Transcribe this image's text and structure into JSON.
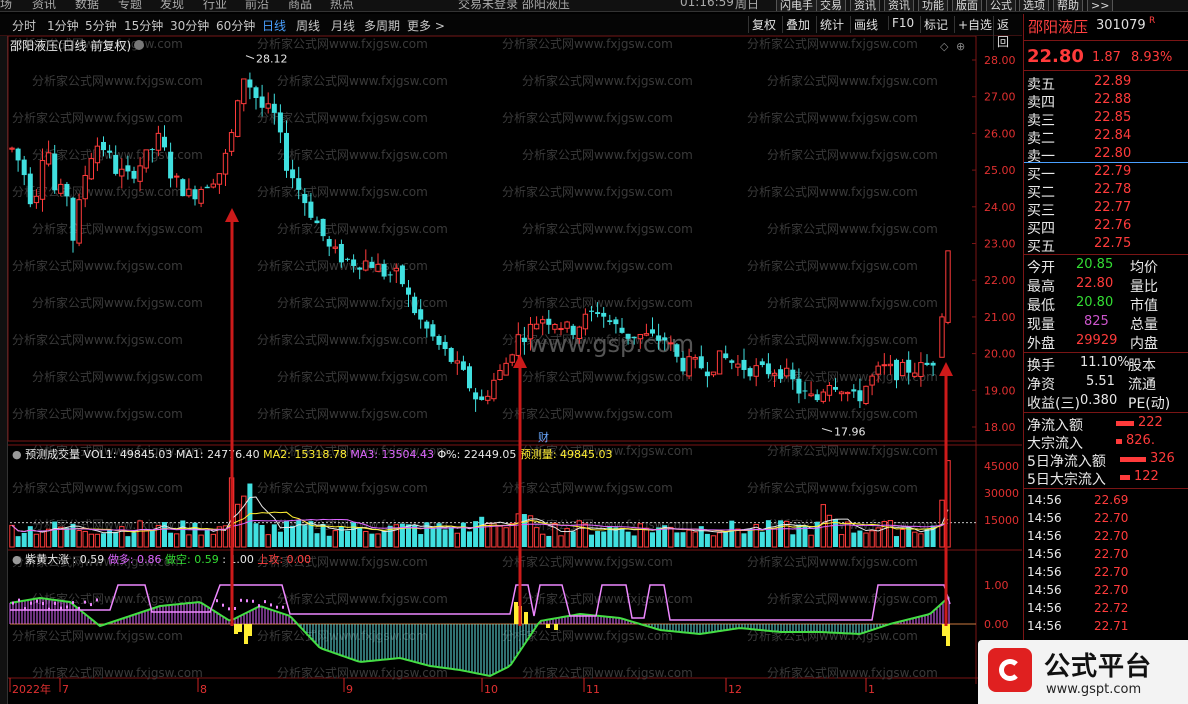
{
  "top_menu": {
    "items": [
      "场",
      "资讯",
      "数据",
      "专题",
      "发现",
      "行业",
      "前沿",
      "商品",
      "热点"
    ],
    "center_text": "交易未登录  邵阳液压",
    "time": "01:16:59",
    "weekday": "周日",
    "buttons": [
      "闪电手",
      "交易",
      "资讯",
      "资讯",
      "功能",
      "版面",
      "公式",
      "选项",
      "帮助",
      ">>"
    ]
  },
  "period_bar": {
    "periods": [
      "分时",
      "1分钟",
      "5分钟",
      "15分钟",
      "30分钟",
      "60分钟",
      "日线",
      "周线",
      "月线",
      "多周期",
      "更多 >"
    ],
    "active": "日线",
    "tools": [
      "复权",
      "叠加",
      "统计",
      "画线",
      "F10",
      "标记",
      "+自选",
      "返回"
    ]
  },
  "main_chart": {
    "title": "邵阳液压(日线 前复权)",
    "watermark": "分析家公式网www.fxjgsw.com",
    "center_watermark": "www.gsp.com",
    "high_label": "28.12",
    "low_label": "17.96",
    "y_ticks": [
      "28.00",
      "27.00",
      "26.00",
      "25.00",
      "24.00",
      "23.00",
      "22.00",
      "21.00",
      "20.00",
      "19.00",
      "18.00"
    ],
    "cai_marker": "财"
  },
  "volume_panel": {
    "name": "预测成交量",
    "vol1_label": "VOL1: 49845.03",
    "ma1_label": "MA1: 24776.40",
    "ma2_label": "MA2: 15318.78",
    "ma3_label": "MA3: 13504.43",
    "pct_label": "Φ%: 22449.05",
    "forecast_label": "预测量: 49845.03",
    "y_ticks": [
      "45000",
      "30000",
      "15000"
    ]
  },
  "indicator_panel": {
    "name": "紫黄大涨",
    "v1": ": 0.59",
    "v2": "做多: 0.86",
    "v3": "做空: 0.59",
    "v4": ": 1.00",
    "v5": "上攻: 0.00",
    "y_ticks": [
      "1.00",
      "0.00"
    ]
  },
  "x_axis": [
    "2022年",
    "7",
    "8",
    "9",
    "10",
    "11",
    "12",
    "1"
  ],
  "right_panel": {
    "name": "邵阳液压",
    "code": "301079",
    "flag": "R",
    "price": "22.80",
    "change": "1.87",
    "change_pct": "8.93%",
    "asks": [
      {
        "label": "卖五",
        "price": "22.89"
      },
      {
        "label": "卖四",
        "price": "22.88"
      },
      {
        "label": "卖三",
        "price": "22.85"
      },
      {
        "label": "卖二",
        "price": "22.84"
      },
      {
        "label": "卖一",
        "price": "22.80"
      }
    ],
    "bids": [
      {
        "label": "买一",
        "price": "22.79"
      },
      {
        "label": "买二",
        "price": "22.78"
      },
      {
        "label": "买三",
        "price": "22.77"
      },
      {
        "label": "买四",
        "price": "22.76"
      },
      {
        "label": "买五",
        "price": "22.75"
      }
    ],
    "stats": [
      {
        "l": "今开",
        "v": "20.85",
        "c": "#33dd33",
        "r": "均价"
      },
      {
        "l": "最高",
        "v": "22.80",
        "c": "#ff3b3b",
        "r": "量比"
      },
      {
        "l": "最低",
        "v": "20.80",
        "c": "#33dd33",
        "r": "市值"
      },
      {
        "l": "现量",
        "v": "825",
        "c": "#cc55cc",
        "r": "总量"
      },
      {
        "l": "外盘",
        "v": "29929",
        "c": "#ff3b3b",
        "r": "内盘"
      }
    ],
    "stats2": [
      {
        "l": "换手",
        "v": "11.10%",
        "r": "股本"
      },
      {
        "l": "净资",
        "v": "5.51",
        "r": "流通"
      },
      {
        "l": "收益(三)",
        "v": "0.380",
        "r": "PE(动)"
      }
    ],
    "flows": [
      {
        "l": "净流入额",
        "v": "222"
      },
      {
        "l": "大宗流入",
        "v": "826."
      },
      {
        "l": "5日净流入额",
        "v": "326"
      },
      {
        "l": "5日大宗流入",
        "v": "122"
      }
    ],
    "ticks": [
      {
        "t": "14:56",
        "v": "22.69"
      },
      {
        "t": "14:56",
        "v": "22.70"
      },
      {
        "t": "14:56",
        "v": "22.70"
      },
      {
        "t": "14:56",
        "v": "22.70"
      },
      {
        "t": "14:56",
        "v": "22.70"
      },
      {
        "t": "14:56",
        "v": "22.70"
      },
      {
        "t": "14:56",
        "v": "22.72"
      },
      {
        "t": "14:56",
        "v": "22.71"
      }
    ]
  },
  "logo": {
    "text": "公式平台",
    "url": "www.gspt.com"
  },
  "colors": {
    "up": "#ff3b3b",
    "down": "#40e0e0",
    "grid": "#7a1515",
    "arrow": "#cc1a1a",
    "purple": "#dd66ff",
    "yellow": "#ffee33",
    "green": "#33dd33"
  }
}
